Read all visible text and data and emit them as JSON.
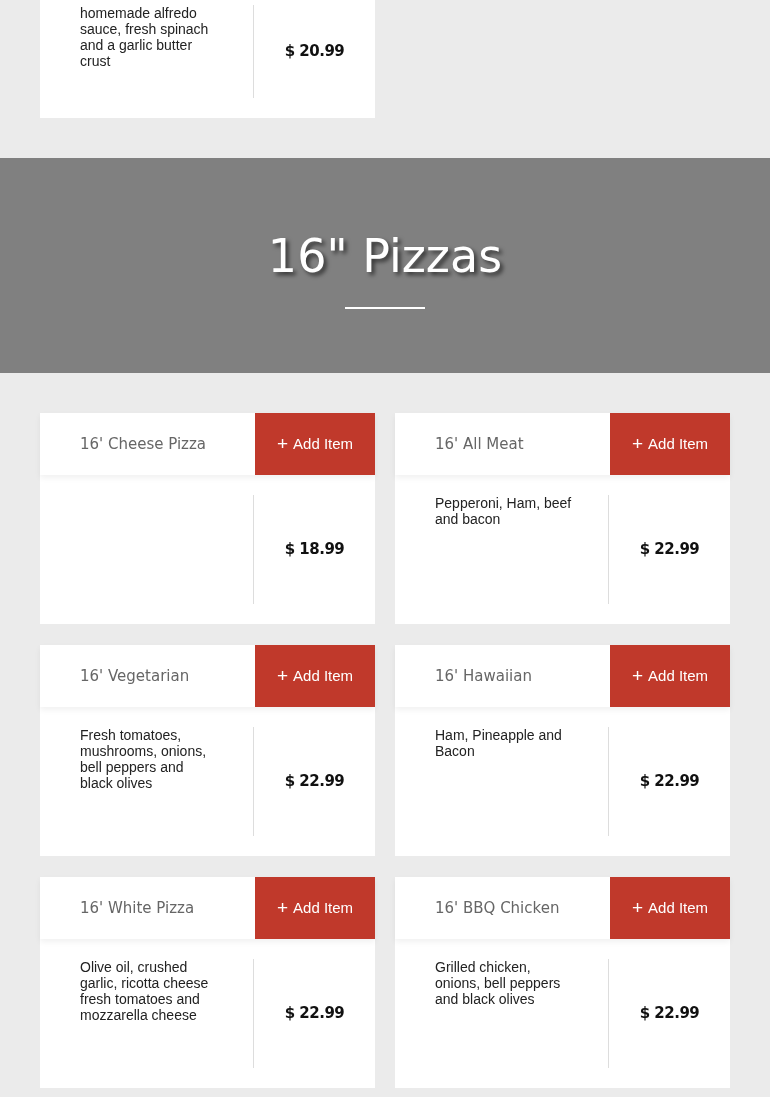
{
  "previous_item": {
    "description": "homemade alfredo sauce, fresh spinach and a garlic butter crust",
    "price": "$ 20.99"
  },
  "section": {
    "title": "16\" Pizzas"
  },
  "items": [
    {
      "name": "16' Cheese Pizza",
      "button": "Add Item",
      "button_icon": "+",
      "price": "$ 18.99"
    },
    {
      "name": "16' All Meat",
      "button": "Add Item",
      "button_icon": "+",
      "description": "Pepperoni, Ham, beef and bacon",
      "price": "$ 22.99"
    },
    {
      "name": "16' Vegetarian",
      "button": "Add Item",
      "button_icon": "+",
      "description": "Fresh tomatoes, mushrooms, onions, bell peppers and black olives",
      "price": "$ 22.99"
    },
    {
      "name": "16' Hawaiian",
      "button": "Add Item",
      "button_icon": "+",
      "description": "Ham, Pineapple and Bacon",
      "price": "$ 22.99"
    },
    {
      "name": "16' White Pizza",
      "button": "Add Item",
      "button_icon": "+",
      "description": "Olive oil, crushed garlic, ricotta cheese fresh tomatoes and mozzarella cheese",
      "price": "$ 22.99"
    },
    {
      "name": "16' BBQ Chicken",
      "button": "Add Item",
      "button_icon": "+",
      "description": "Grilled chicken, onions, bell peppers and black olives",
      "price": "$ 22.99"
    }
  ]
}
